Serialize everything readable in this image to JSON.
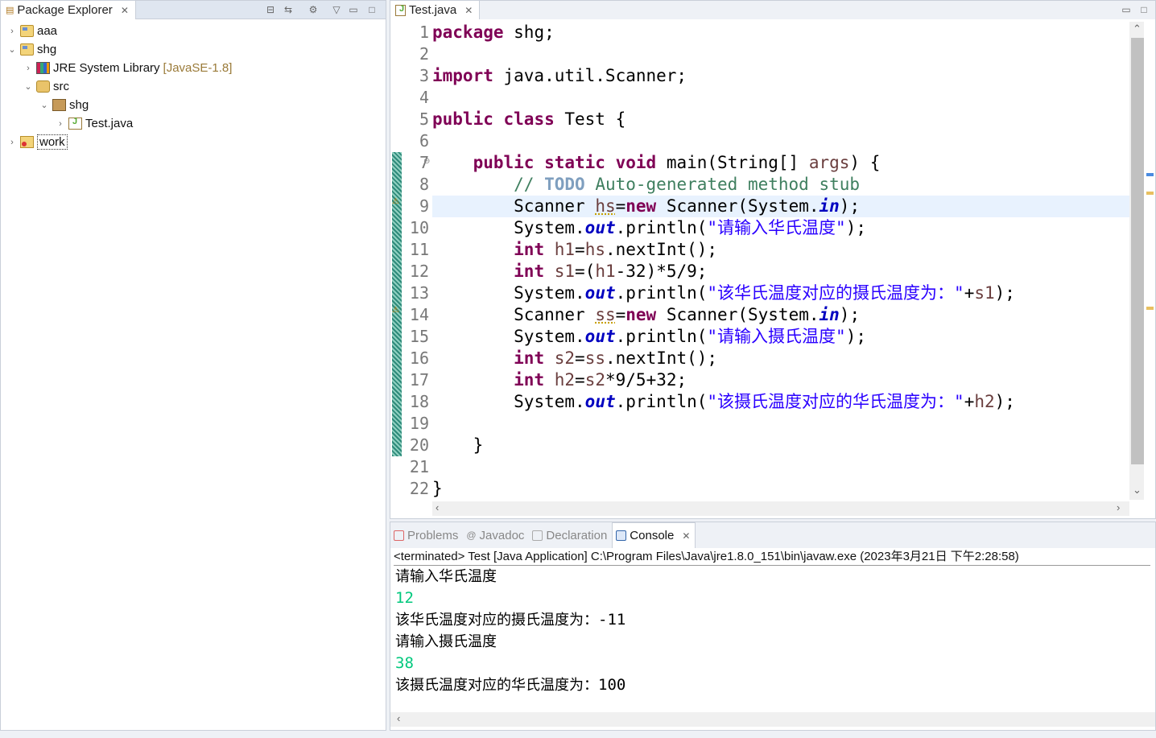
{
  "package_explorer": {
    "title": "Package Explorer",
    "tree": [
      {
        "label": "aaa",
        "suffix": "",
        "chevron": "›"
      },
      {
        "label": "shg",
        "suffix": "",
        "chevron": "⌄"
      },
      {
        "label": "JRE System Library",
        "suffix": "[JavaSE-1.8]",
        "chevron": "›"
      },
      {
        "label": "src",
        "suffix": "",
        "chevron": "⌄"
      },
      {
        "label": "shg",
        "suffix": "",
        "chevron": "⌄"
      },
      {
        "label": "Test.java",
        "suffix": "",
        "chevron": "›"
      },
      {
        "label": "work",
        "suffix": "",
        "chevron": "›"
      }
    ]
  },
  "editor": {
    "tab_label": "Test.java",
    "line_numbers": [
      "1",
      "2",
      "3",
      "4",
      "5",
      "6",
      "7",
      "8",
      "9",
      "10",
      "11",
      "12",
      "13",
      "14",
      "15",
      "16",
      "17",
      "18",
      "19",
      "20",
      "21",
      "22"
    ],
    "highlighted_line": 9,
    "code": {
      "l1_kw": "package",
      "l1_rest": " shg;",
      "l3_kw": "import",
      "l3_rest": " java.util.Scanner;",
      "l5_kw1": "public",
      "l5_kw2": "class",
      "l5_rest": " Test {",
      "l7_kw1": "public",
      "l7_kw2": "static",
      "l7_kw3": "void",
      "l7_rest1": " main(String[] ",
      "l7_var": "args",
      "l7_rest2": ") {",
      "l8_cm1": "// ",
      "l8_todo": "TODO",
      "l8_cm2": " Auto-generated method stub",
      "l9_a": "Scanner ",
      "l9_var": "hs",
      "l9_b": "=",
      "l9_kw": "new",
      "l9_c": " Scanner(System.",
      "l9_fld": "in",
      "l9_d": ");",
      "l10_a": "System.",
      "l10_fld": "out",
      "l10_b": ".println(",
      "l10_st": "\"请输入华氏温度\"",
      "l10_c": ");",
      "l11_kw": "int",
      "l11_a": " ",
      "l11_var1": "h1",
      "l11_b": "=",
      "l11_var2": "hs",
      "l11_c": ".nextInt();",
      "l12_kw": "int",
      "l12_a": " ",
      "l12_var1": "s1",
      "l12_b": "=(",
      "l12_var2": "h1",
      "l12_c": "-32)*5/9;",
      "l13_a": "System.",
      "l13_fld": "out",
      "l13_b": ".println(",
      "l13_st": "\"该华氏温度对应的摄氏温度为：\"",
      "l13_c": "+",
      "l13_var": "s1",
      "l13_d": ");",
      "l14_a": "Scanner ",
      "l14_var": "ss",
      "l14_b": "=",
      "l14_kw": "new",
      "l14_c": " Scanner(System.",
      "l14_fld": "in",
      "l14_d": ");",
      "l15_a": "System.",
      "l15_fld": "out",
      "l15_b": ".println(",
      "l15_st": "\"请输入摄氏温度\"",
      "l15_c": ");",
      "l16_kw": "int",
      "l16_a": " ",
      "l16_var1": "s2",
      "l16_b": "=",
      "l16_var2": "ss",
      "l16_c": ".nextInt();",
      "l17_kw": "int",
      "l17_a": " ",
      "l17_var1": "h2",
      "l17_b": "=",
      "l17_var2": "s2",
      "l17_c": "*9/5+32;",
      "l18_a": "System.",
      "l18_fld": "out",
      "l18_b": ".println(",
      "l18_st": "\"该摄氏温度对应的华氏温度为：\"",
      "l18_c": "+",
      "l18_var": "h2",
      "l18_d": ");",
      "l20": "}",
      "l22": "}"
    }
  },
  "console": {
    "tabs": [
      {
        "label": "Problems",
        "icon": "problems-icon"
      },
      {
        "label": "Javadoc",
        "icon": "javadoc-icon"
      },
      {
        "label": "Declaration",
        "icon": "declaration-icon"
      },
      {
        "label": "Console",
        "icon": "console-icon"
      }
    ],
    "terminated_line": "<terminated> Test [Java Application] C:\\Program Files\\Java\\jre1.8.0_151\\bin\\javaw.exe (2023年3月21日 下午2:28:58)",
    "output": [
      {
        "prefix": "请输入华氏温度",
        "value": ""
      },
      {
        "prefix": "",
        "value": "12"
      },
      {
        "prefix": "该华氏温度对应的摄氏温度为：",
        "value": "-11"
      },
      {
        "prefix": "请输入摄氏温度",
        "value": ""
      },
      {
        "prefix": "",
        "value": "38"
      },
      {
        "prefix": "该摄氏温度对应的华氏温度为：",
        "value": "100"
      }
    ]
  },
  "colors": {
    "keyword": "#7f0055",
    "comment": "#3f7f5f",
    "string": "#2a00ff",
    "field": "#0000c0",
    "console_input": "#00c87d",
    "line_highlight": "#e8f2fe"
  }
}
